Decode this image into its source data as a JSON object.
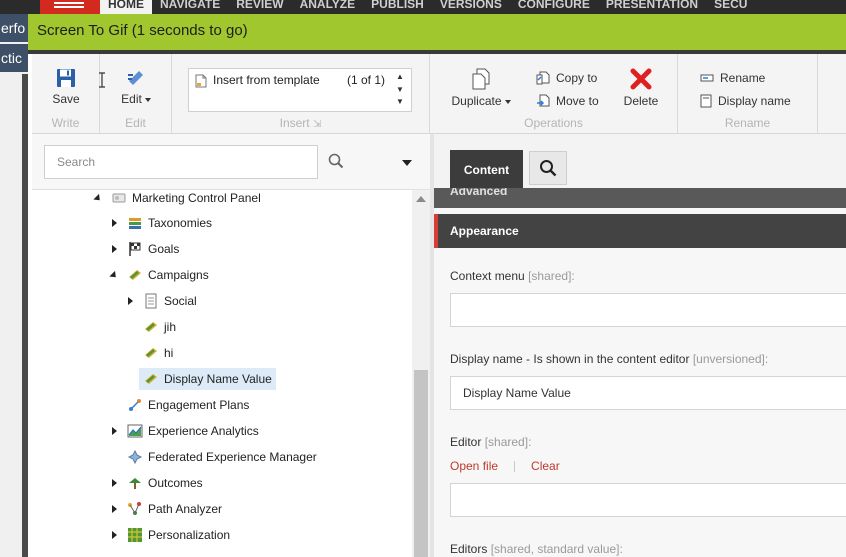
{
  "nav": {
    "tabs": [
      "HOME",
      "NAVIGATE",
      "REVIEW",
      "ANALYZE",
      "PUBLISH",
      "VERSIONS",
      "CONFIGURE",
      "PRESENTATION",
      "SECU"
    ],
    "active": "HOME"
  },
  "left_window": {
    "text1": "erfo",
    "text2": "ctic"
  },
  "gif_recorder": {
    "title": "Screen To Gif (1 seconds to go)"
  },
  "ribbon": {
    "write": {
      "label": "Write",
      "save": "Save"
    },
    "edit": {
      "label": "Edit",
      "edit": "Edit"
    },
    "insert": {
      "label": "Insert",
      "item": "Insert from template",
      "count": "(1 of 1)"
    },
    "operations": {
      "label": "Operations",
      "duplicate": "Duplicate",
      "copy_to": "Copy to",
      "move_to": "Move to",
      "delete": "Delete"
    },
    "rename": {
      "label": "Rename",
      "rename": "Rename",
      "display_name": "Display name"
    }
  },
  "search": {
    "placeholder": "Search"
  },
  "tree": {
    "items": [
      {
        "label": "Marketing Control Panel",
        "icon": "control-panel-icon"
      },
      {
        "label": "Taxonomies",
        "icon": "taxonomies-icon"
      },
      {
        "label": "Goals",
        "icon": "goals-flag-icon"
      },
      {
        "label": "Campaigns",
        "icon": "campaign-icon"
      },
      {
        "label": "Social",
        "icon": "document-icon"
      },
      {
        "label": "jih",
        "icon": "campaign-icon"
      },
      {
        "label": "hi",
        "icon": "campaign-icon"
      },
      {
        "label": "Display Name Value",
        "icon": "campaign-icon"
      },
      {
        "label": "Engagement Plans",
        "icon": "engagement-plan-icon"
      },
      {
        "label": "Experience Analytics",
        "icon": "analytics-chart-icon"
      },
      {
        "label": "Federated Experience Manager",
        "icon": "fxm-icon"
      },
      {
        "label": "Outcomes",
        "icon": "outcomes-icon"
      },
      {
        "label": "Path Analyzer",
        "icon": "path-analyzer-icon"
      },
      {
        "label": "Personalization",
        "icon": "personalization-icon"
      }
    ]
  },
  "content": {
    "tab": "Content",
    "section_advanced": "Advanced",
    "section_appearance": "Appearance",
    "fields": {
      "context_menu": {
        "label": "Context menu",
        "hint": "[shared]:",
        "value": ""
      },
      "display_name": {
        "label": "Display name - Is shown in the content editor",
        "hint": "[unversioned]:",
        "value": "Display Name Value"
      },
      "editor": {
        "label": "Editor",
        "hint": "[shared]:",
        "open_file": "Open file",
        "clear": "Clear",
        "value": ""
      },
      "editors": {
        "label": "Editors",
        "hint": "[shared, standard value]:"
      }
    }
  },
  "colors": {
    "green_bar": "#a1c72e",
    "accent_red": "#d63b34",
    "dark_tab": "#3c3c3c",
    "selection": "#dcebf7"
  }
}
